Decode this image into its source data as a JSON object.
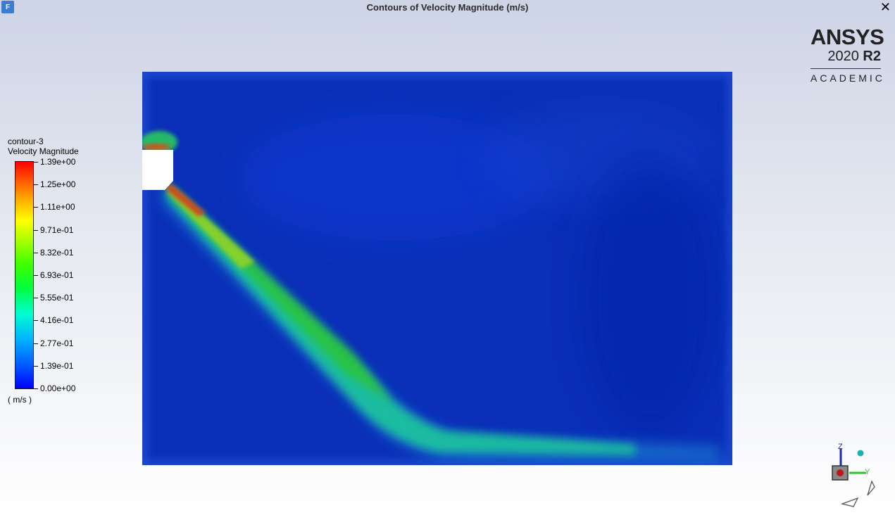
{
  "window": {
    "title": "Contours of Velocity Magnitude (m/s)",
    "app_icon_letter": "F",
    "close_glyph": "✕"
  },
  "logo": {
    "brand": "ANSYS",
    "version_year": "2020",
    "version_release": "R2",
    "edition": "ACADEMIC"
  },
  "legend": {
    "name": "contour-3",
    "quantity": "Velocity Magnitude",
    "unit": "( m/s )",
    "tick_labels": [
      "1.39e+00",
      "1.25e+00",
      "1.11e+00",
      "9.71e-01",
      "8.32e-01",
      "6.93e-01",
      "5.55e-01",
      "4.16e-01",
      "2.77e-01",
      "1.39e-01",
      "0.00e+00"
    ],
    "colormap": [
      "#0000ff",
      "#0060ff",
      "#00b4ff",
      "#00ffd0",
      "#00ff40",
      "#40ff00",
      "#b0ff00",
      "#ffff00",
      "#ffb000",
      "#ff6000",
      "#ff0000"
    ],
    "range": [
      0.0,
      1.39
    ]
  },
  "triad": {
    "z_label": "Z",
    "y_label": "Y"
  },
  "colors": {
    "background_top": "#cdd4e6",
    "background_bottom": "#ffffff",
    "domain_base": "#0b2fb8"
  }
}
